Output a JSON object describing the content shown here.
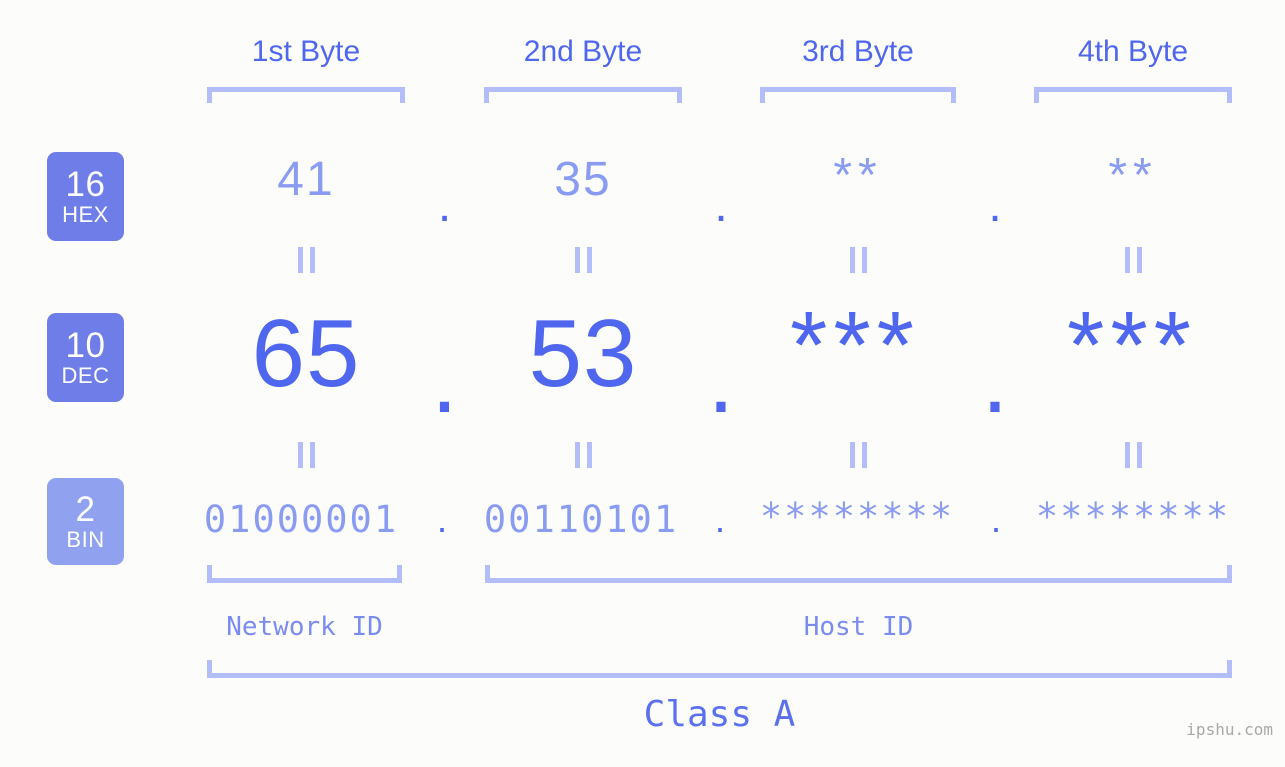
{
  "watermark": "ipshu.com",
  "byte_headers": [
    {
      "label": "1st Byte"
    },
    {
      "label": "2nd Byte"
    },
    {
      "label": "3rd Byte"
    },
    {
      "label": "4th Byte"
    }
  ],
  "bases": [
    {
      "number": "16",
      "name": "HEX",
      "color": "#6f7de8"
    },
    {
      "number": "10",
      "name": "DEC",
      "color": "#6f7de8"
    },
    {
      "number": "2",
      "name": "BIN",
      "color": "#8fa1ef"
    }
  ],
  "rows": {
    "hex": {
      "base_number": "16",
      "base_name": "HEX",
      "values": [
        "41",
        "35",
        "**",
        "**"
      ],
      "separator": "."
    },
    "dec": {
      "base_number": "10",
      "base_name": "DEC",
      "values": [
        "65",
        "53",
        "***",
        "***"
      ],
      "separator": "."
    },
    "bin": {
      "base_number": "2",
      "base_name": "BIN",
      "values": [
        "01000001",
        "00110101",
        "********",
        "********"
      ],
      "separator": "."
    }
  },
  "equals_glyph": "||",
  "segments": {
    "network_id": "Network ID",
    "host_id": "Host ID"
  },
  "class_label": "Class A",
  "colors": {
    "background": "#fcfdfa",
    "accent_strong": "#4f66ef",
    "accent_mid": "#8a9bf2",
    "accent_light": "#b3bdfa",
    "badge_dark": "#6f7de8",
    "badge_light": "#8fa1ef",
    "watermark": "#a9a9a9"
  }
}
